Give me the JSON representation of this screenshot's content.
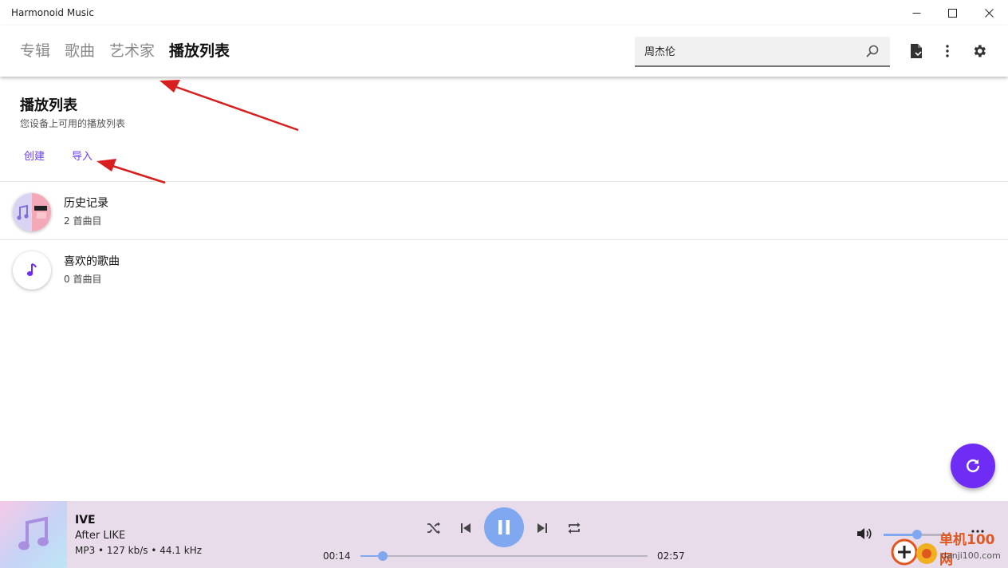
{
  "window": {
    "title": "Harmonoid Music"
  },
  "tabs": [
    {
      "label": "专辑",
      "active": false
    },
    {
      "label": "歌曲",
      "active": false
    },
    {
      "label": "艺术家",
      "active": false
    },
    {
      "label": "播放列表",
      "active": true
    }
  ],
  "search": {
    "value": "周杰伦"
  },
  "section": {
    "title": "播放列表",
    "subtitle": "您设备上可用的播放列表",
    "create_label": "创建",
    "import_label": "导入"
  },
  "playlists": [
    {
      "name": "历史记录",
      "count": "2 首曲目"
    },
    {
      "name": "喜欢的歌曲",
      "count": "0 首曲目"
    }
  ],
  "player": {
    "title": "IVE",
    "subtitle": "After LIKE",
    "meta": "MP3 • 127 kb/s • 44.1 kHz",
    "elapsed": "00:14",
    "duration": "02:57",
    "progress_fraction": 0.079,
    "volume_fraction": 0.5
  },
  "watermark": {
    "line1": "单机100网",
    "line2": "danji100.com"
  },
  "colors": {
    "accent": "#6f2cf5",
    "player_bg": "#e8dcea",
    "player_accent": "#7fa8f0",
    "annotation_arrow": "#d81e1e"
  }
}
